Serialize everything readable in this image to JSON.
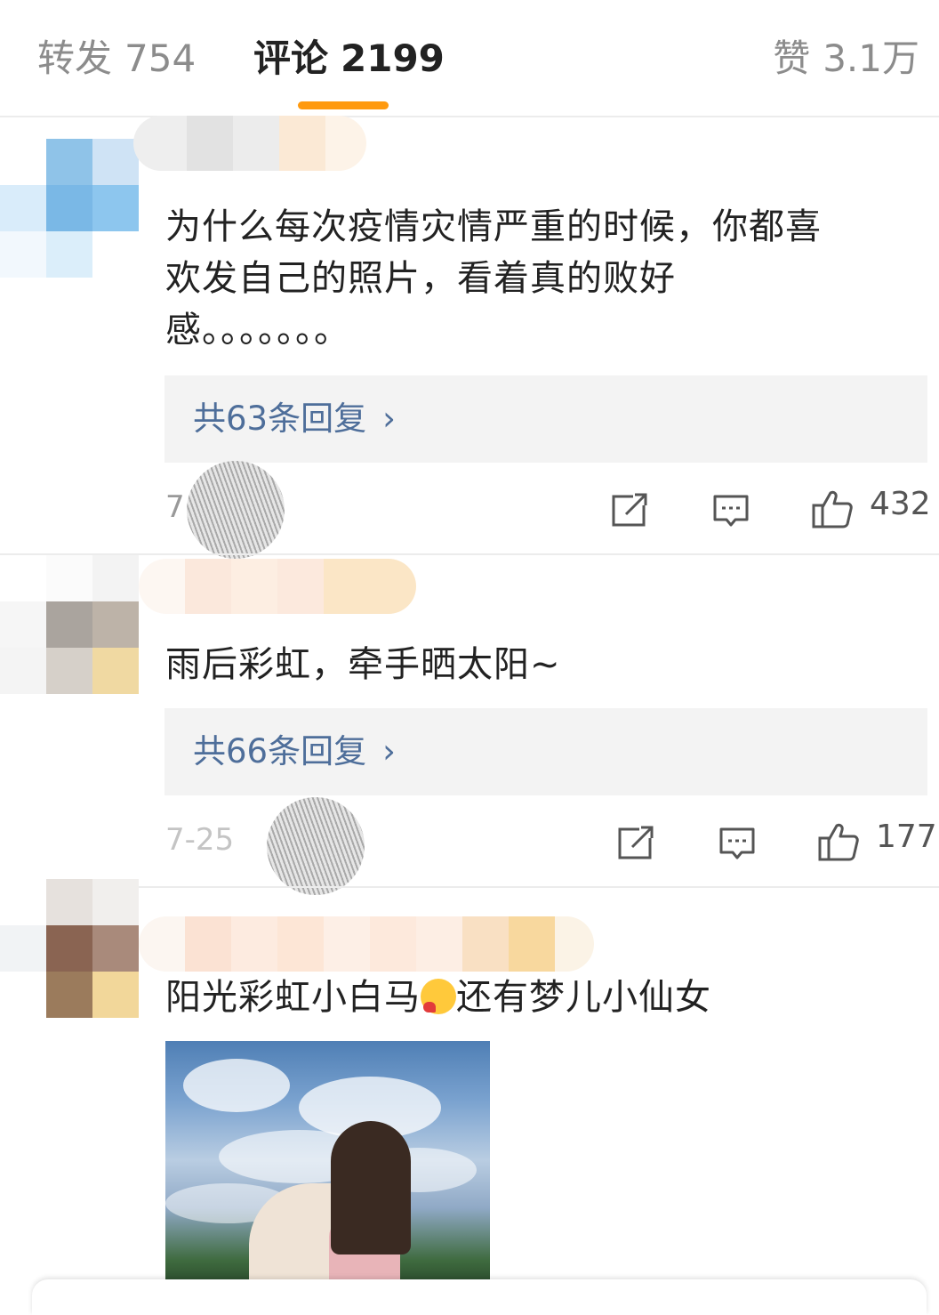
{
  "tabs": {
    "repost": {
      "label": "转发",
      "count": "754"
    },
    "comments": {
      "label": "评论",
      "count": "2199"
    },
    "likes": {
      "label": "赞",
      "count": "3.1万"
    }
  },
  "comments": [
    {
      "text": "为什么每次疫情灾情严重的时候，你都喜欢发自己的照片，看着真的败好感。。。。。。。",
      "replies_label": "共63条回复",
      "timestamp_visible": "7",
      "like_count": "432"
    },
    {
      "text": "雨后彩虹，牵手晒太阳~",
      "replies_label": "共66条回复",
      "timestamp_visible": "7-25",
      "like_count": "177"
    },
    {
      "text_before_emoji": "阳光彩虹小白马",
      "emoji": "heart-face-emoji",
      "text_after_emoji": "还有梦儿小仙女"
    }
  ],
  "icons": {
    "repost": "share-icon",
    "reply": "comment-icon",
    "like": "thumbs-up-icon",
    "chevron": "chevron-right-icon"
  },
  "colors": {
    "accent": "#ff9a0f",
    "link": "#4e6e9a",
    "reply_box_bg": "#f3f3f3"
  }
}
